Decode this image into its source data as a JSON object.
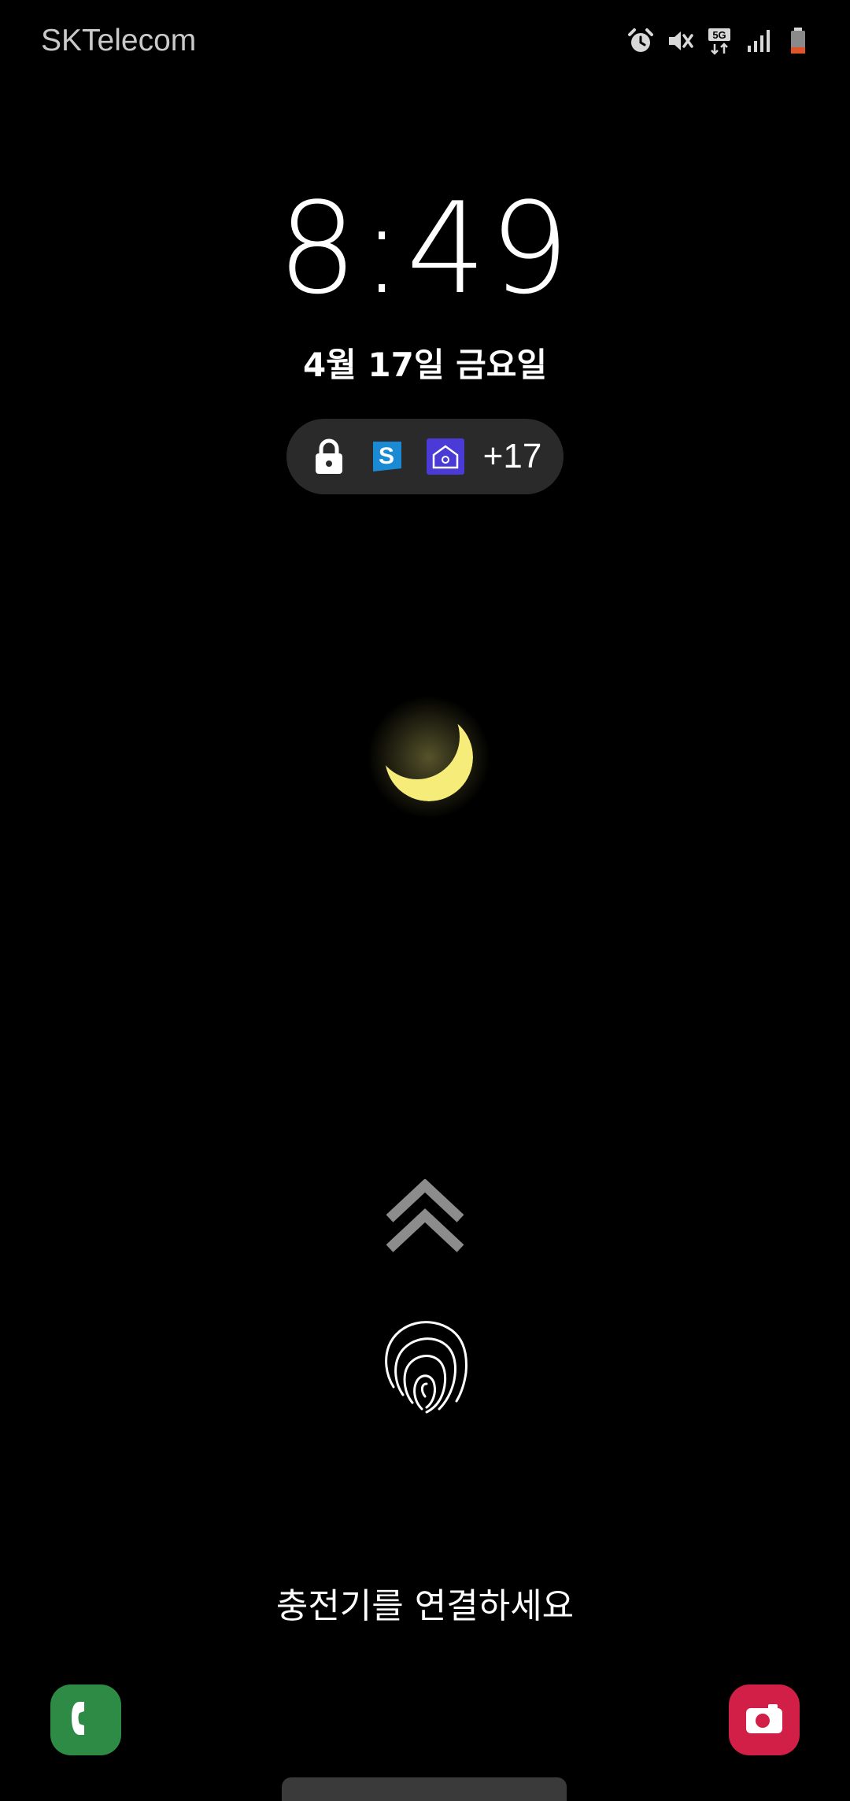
{
  "status_bar": {
    "carrier": "SKTelecom",
    "network": "5G",
    "icons": [
      "alarm-icon",
      "mute-icon",
      "5g-data-icon",
      "signal-icon",
      "battery-low-icon"
    ]
  },
  "lock_screen": {
    "time": "8:49",
    "date": "4월 17일 금요일",
    "notification_overflow": "+17",
    "notification_icons": [
      "lock-icon",
      "s-app-icon",
      "school-app-icon"
    ],
    "charge_message": "충전기를 연결하세요"
  },
  "shortcuts": {
    "left": "phone-icon",
    "right": "camera-icon"
  },
  "colors": {
    "background": "#000000",
    "moon": "#f5ec7a",
    "phone_shortcut": "#2e8b45",
    "camera_shortcut": "#d21f47",
    "pill": "#2a2a2a",
    "battery_low": "#e0542a"
  }
}
